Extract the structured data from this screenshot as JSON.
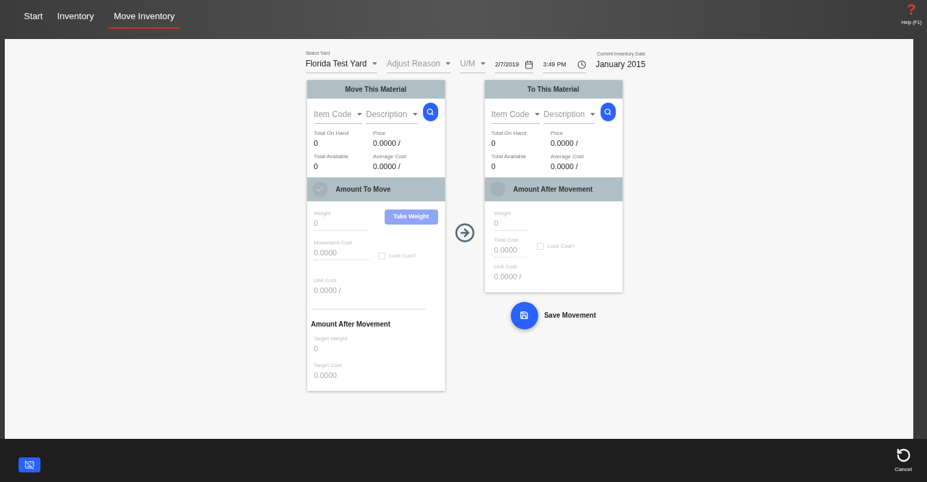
{
  "tabs": [
    {
      "label": "Start",
      "selected": false
    },
    {
      "label": "Inventory",
      "selected": false
    },
    {
      "label": "Move Inventory",
      "selected": true
    }
  ],
  "help": {
    "mark": "?",
    "label": "Help (F1)"
  },
  "filters": {
    "yard": {
      "label": "Select Yard",
      "value": "Florida Test Yard"
    },
    "adjust_reason": {
      "placeholder": "Adjust Reason"
    },
    "um": {
      "placeholder": "U/M"
    },
    "date": {
      "value": "2/7/2019"
    },
    "time": {
      "value": "3:49 PM"
    },
    "inventory_date": {
      "label": "Current Inventory Date",
      "value": "January 2015"
    }
  },
  "source": {
    "title": "Move This Material",
    "item_code": {
      "placeholder": "Item Code"
    },
    "description": {
      "placeholder": "Description"
    },
    "stats": [
      {
        "label": "Total On Hand",
        "value": "0"
      },
      {
        "label": "Price",
        "value": "0.0000 /"
      },
      {
        "label": "Total Available",
        "value": "0"
      },
      {
        "label": "Average Cost",
        "value": "0.0000 /"
      }
    ],
    "section": {
      "title": "Amount To Move",
      "checked": true
    },
    "weight": {
      "label": "Weight",
      "value": "0"
    },
    "take_weight": {
      "label": "Take Weight",
      "disabled": true
    },
    "cost": {
      "label": "Movement Cost",
      "value": "0.0000"
    },
    "lock_cost": {
      "label": "Lock Cost?",
      "checked": false
    },
    "unit_cost": {
      "label": "Unit Cost",
      "value": "0.0000 /"
    },
    "after": {
      "title": "Amount After Movement",
      "fields": [
        {
          "label": "Target Weight",
          "value": "0"
        },
        {
          "label": "Target Cost",
          "value": "0.0000"
        }
      ]
    }
  },
  "target": {
    "title": "To This Material",
    "item_code": {
      "placeholder": "Item Code"
    },
    "description": {
      "placeholder": "Description"
    },
    "stats": [
      {
        "label": "Total On Hand",
        "value": "0"
      },
      {
        "label": "Price",
        "value": "0.0000 /"
      },
      {
        "label": "Total Available",
        "value": "0"
      },
      {
        "label": "Average Cost",
        "value": "0.0000 /"
      }
    ],
    "section": {
      "title": "Amount After Movement",
      "checked": false
    },
    "weight": {
      "label": "Weight",
      "value": "0"
    },
    "cost": {
      "label": "Total Cost",
      "value": "0.0000"
    },
    "lock_cost": {
      "label": "Lock Cost?",
      "checked": false
    },
    "unit_cost": {
      "label": "Unit Cost",
      "value": "0.0000 /"
    }
  },
  "save": {
    "label": "Save Movement"
  },
  "cancel": {
    "label": "Cancel"
  }
}
